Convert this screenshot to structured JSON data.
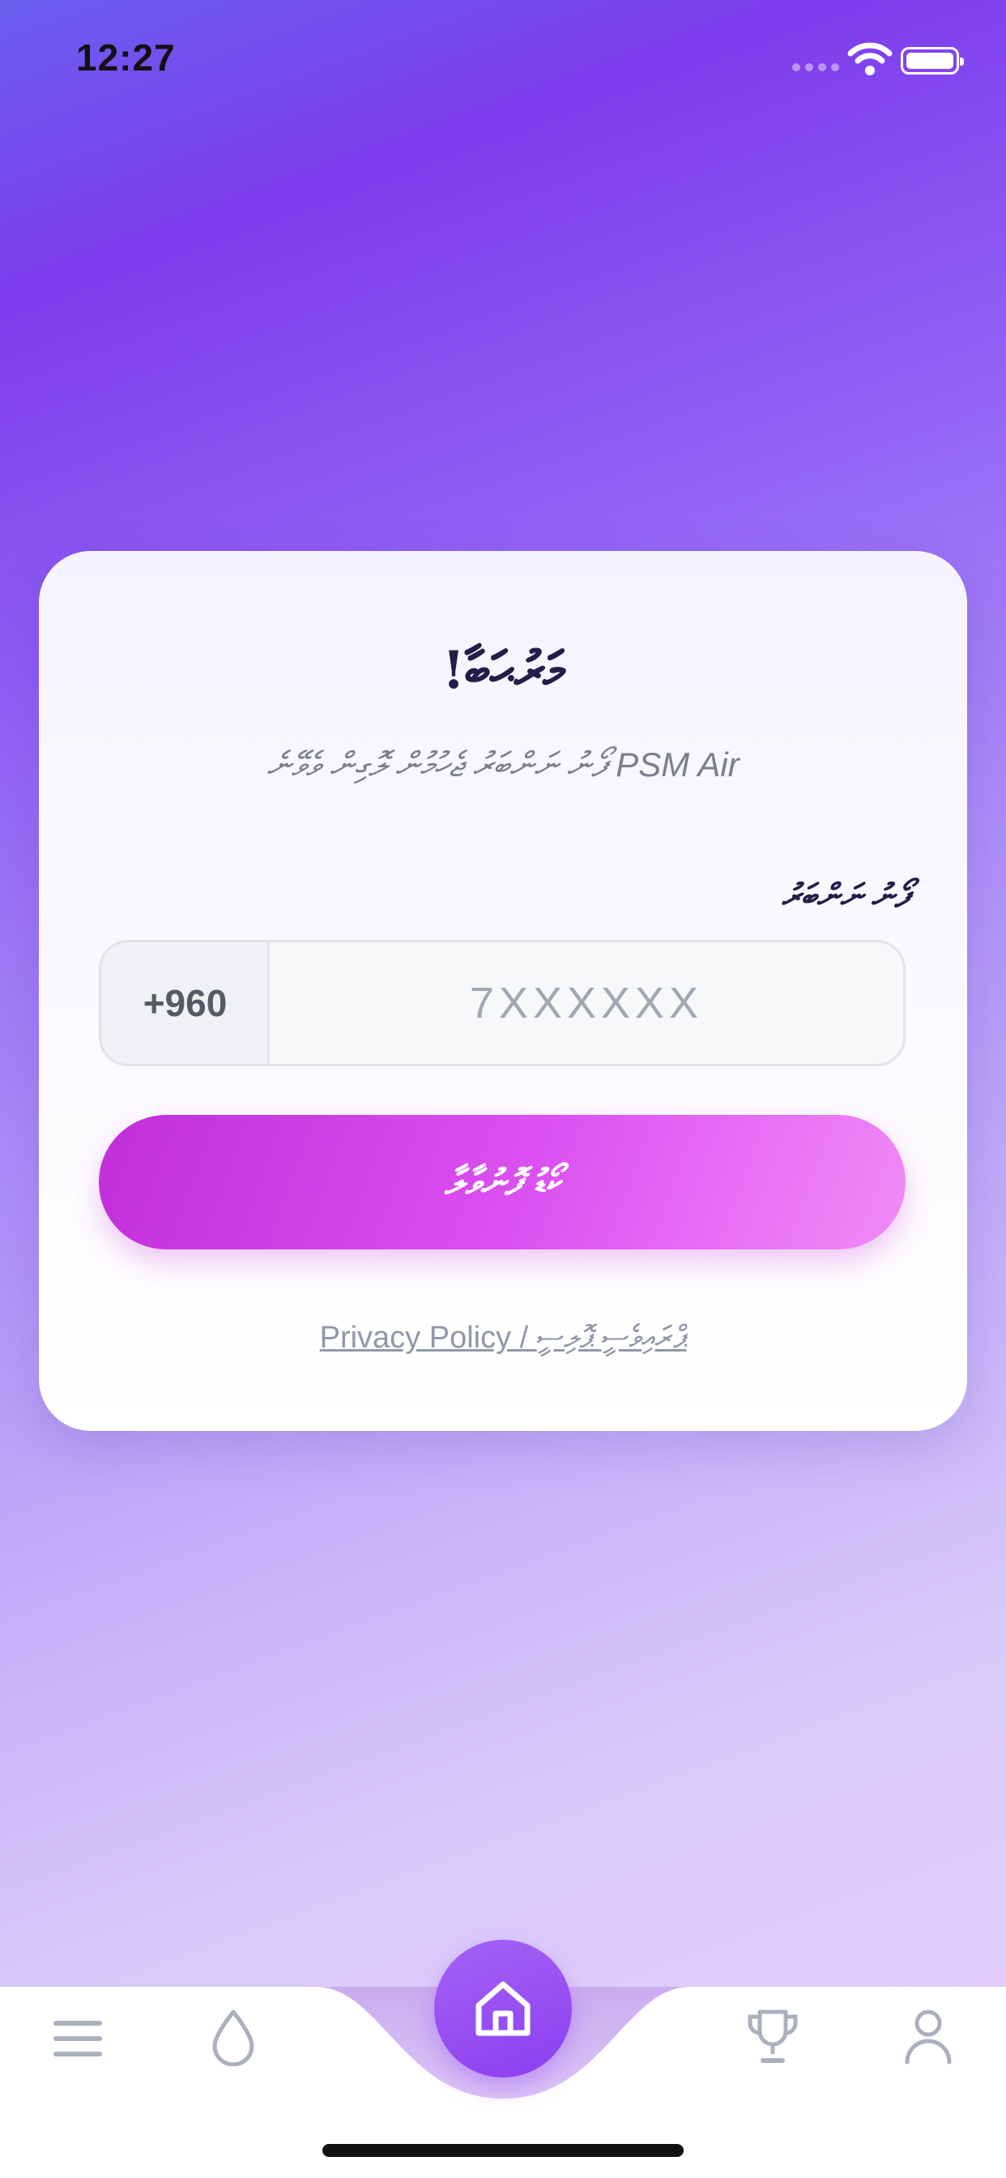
{
  "status_bar": {
    "time": "12:27"
  },
  "login_card": {
    "title": "މަރުޙަބާ!",
    "subtitle": "ފޯނު ނަންބަރު ޖެހުމުން ލޮގިން ވެވޭނެ PSM Air",
    "phone_label": "ފޯނު ނަންބަރު",
    "country_code": "+960",
    "phone_placeholder": "7XXXXXX",
    "phone_value": "",
    "submit_label": "ކޯޑު ފޮނުވާލާ",
    "privacy_link": "Privacy Policy / ޕްރައިވެސީ ޕޮލިސީ"
  },
  "bottom_nav": {
    "items": [
      {
        "name": "menu",
        "icon": "menu-icon"
      },
      {
        "name": "water",
        "icon": "water-drop-icon"
      },
      {
        "name": "home",
        "icon": "home-icon",
        "active": true
      },
      {
        "name": "trophy",
        "icon": "trophy-icon"
      },
      {
        "name": "profile",
        "icon": "user-icon"
      }
    ]
  },
  "colors": {
    "accent": "#8b3ff0",
    "button_start": "#c02ed8",
    "button_end": "#f08bf6",
    "title": "#241d4a",
    "nav_icon": "#aab0bd"
  }
}
